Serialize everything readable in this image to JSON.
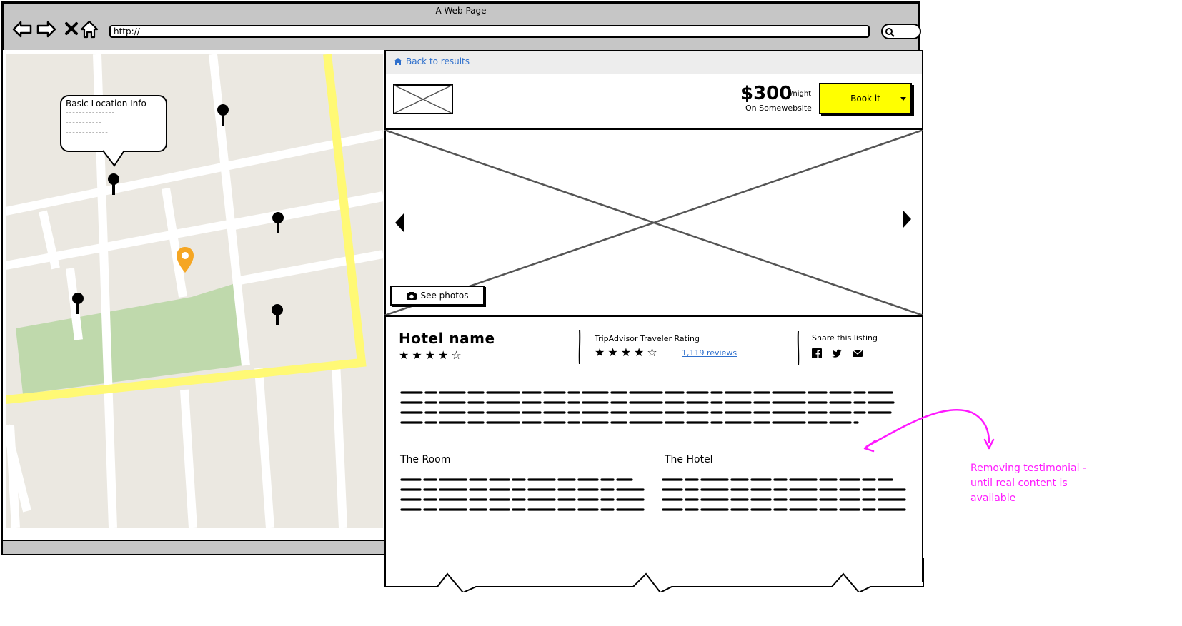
{
  "window": {
    "title": "A Web Page",
    "url": "http://"
  },
  "nav": {
    "back_icon": "back-arrow-icon",
    "forward_icon": "forward-arrow-icon",
    "stop_icon": "close-icon",
    "home_icon": "home-icon",
    "search_icon": "search-icon"
  },
  "map": {
    "callout_title": "Basic Location Info",
    "callout_lines": [
      "---------------",
      "-----------",
      "-------------"
    ],
    "colors": {
      "road": "#ffffff",
      "highway": "#fff975",
      "park": "#bfd9ac",
      "land": "#ebe8e1",
      "selected_pin": "#f5a623"
    }
  },
  "listing": {
    "back_label": "Back to results",
    "price": "$300",
    "price_unit": "/night",
    "price_source": "On Somewebsite",
    "book_label": "Book it",
    "see_photos_label": "See photos",
    "hotel_name": "Hotel name",
    "hotel_stars": 4,
    "hotel_stars_max": 5,
    "rating_label": "TripAdvisor Traveler Rating",
    "rating_stars": 4,
    "reviews_label": "1,119 reviews",
    "share_label": "Share this listing",
    "share_icons": [
      "facebook-icon",
      "twitter-icon",
      "email-icon"
    ],
    "room_title": "The Room",
    "hotel_section_title": "The Hotel",
    "accent_color": "#ffff00",
    "link_color": "#2e6fcc"
  },
  "annotation": {
    "text": "Removing testimonial - until real content is available",
    "color": "#ff19ff"
  }
}
